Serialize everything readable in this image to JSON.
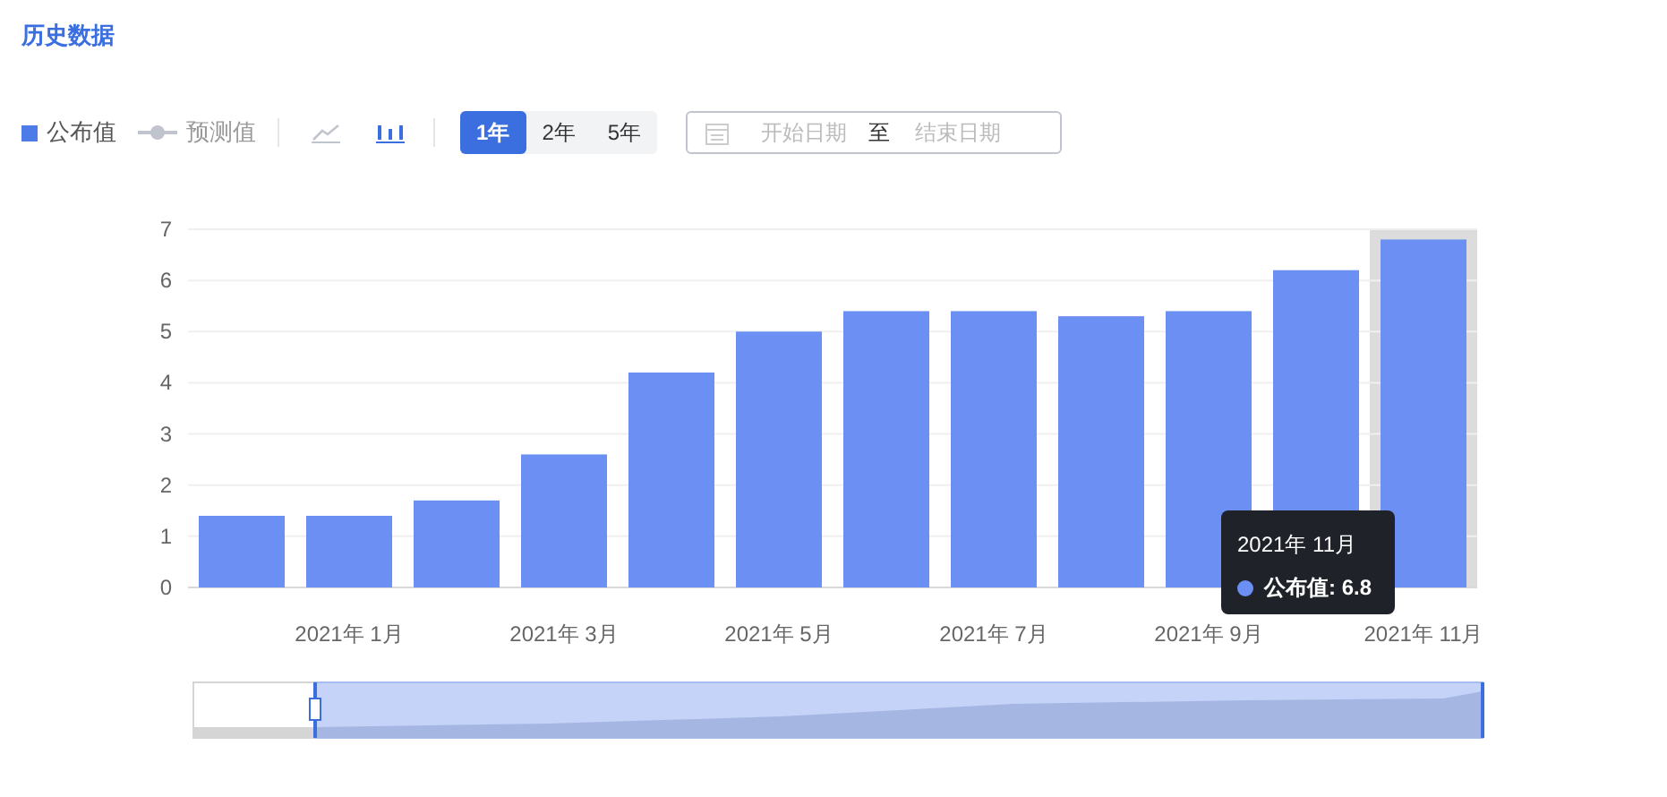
{
  "title": "历史数据",
  "legend": [
    {
      "label": "公布值",
      "kind": "square",
      "color": "#4d7ce8"
    },
    {
      "label": "预测值",
      "kind": "line",
      "color": "#c0c4cc"
    }
  ],
  "chart_types": [
    {
      "kind": "line",
      "selected": false
    },
    {
      "kind": "bar",
      "selected": true
    }
  ],
  "ranges": [
    {
      "label": "1年",
      "selected": true
    },
    {
      "label": "2年",
      "selected": false
    },
    {
      "label": "5年",
      "selected": false
    }
  ],
  "date_range": {
    "start_placeholder": "开始日期",
    "separator": "至",
    "end_placeholder": "结束日期"
  },
  "chart_data": {
    "type": "bar",
    "categories": [
      null,
      "2021年 1月",
      null,
      "2021年 3月",
      null,
      "2021年 5月",
      null,
      "2021年 7月",
      null,
      "2021年 9月",
      null,
      "2021年 11月"
    ],
    "series": [
      {
        "color": "#6b8ff2",
        "values": [
          1.4,
          1.4,
          1.7,
          2.6,
          4.2,
          5.0,
          5.4,
          5.4,
          5.3,
          5.4,
          6.2,
          6.8
        ]
      }
    ],
    "ylim": [
      0,
      7
    ],
    "yticks": [
      0,
      1,
      2,
      3,
      4,
      5,
      6,
      7
    ],
    "grid": true
  },
  "tooltip": {
    "title": "2021年 11月",
    "text": "公布值: 6.8"
  }
}
